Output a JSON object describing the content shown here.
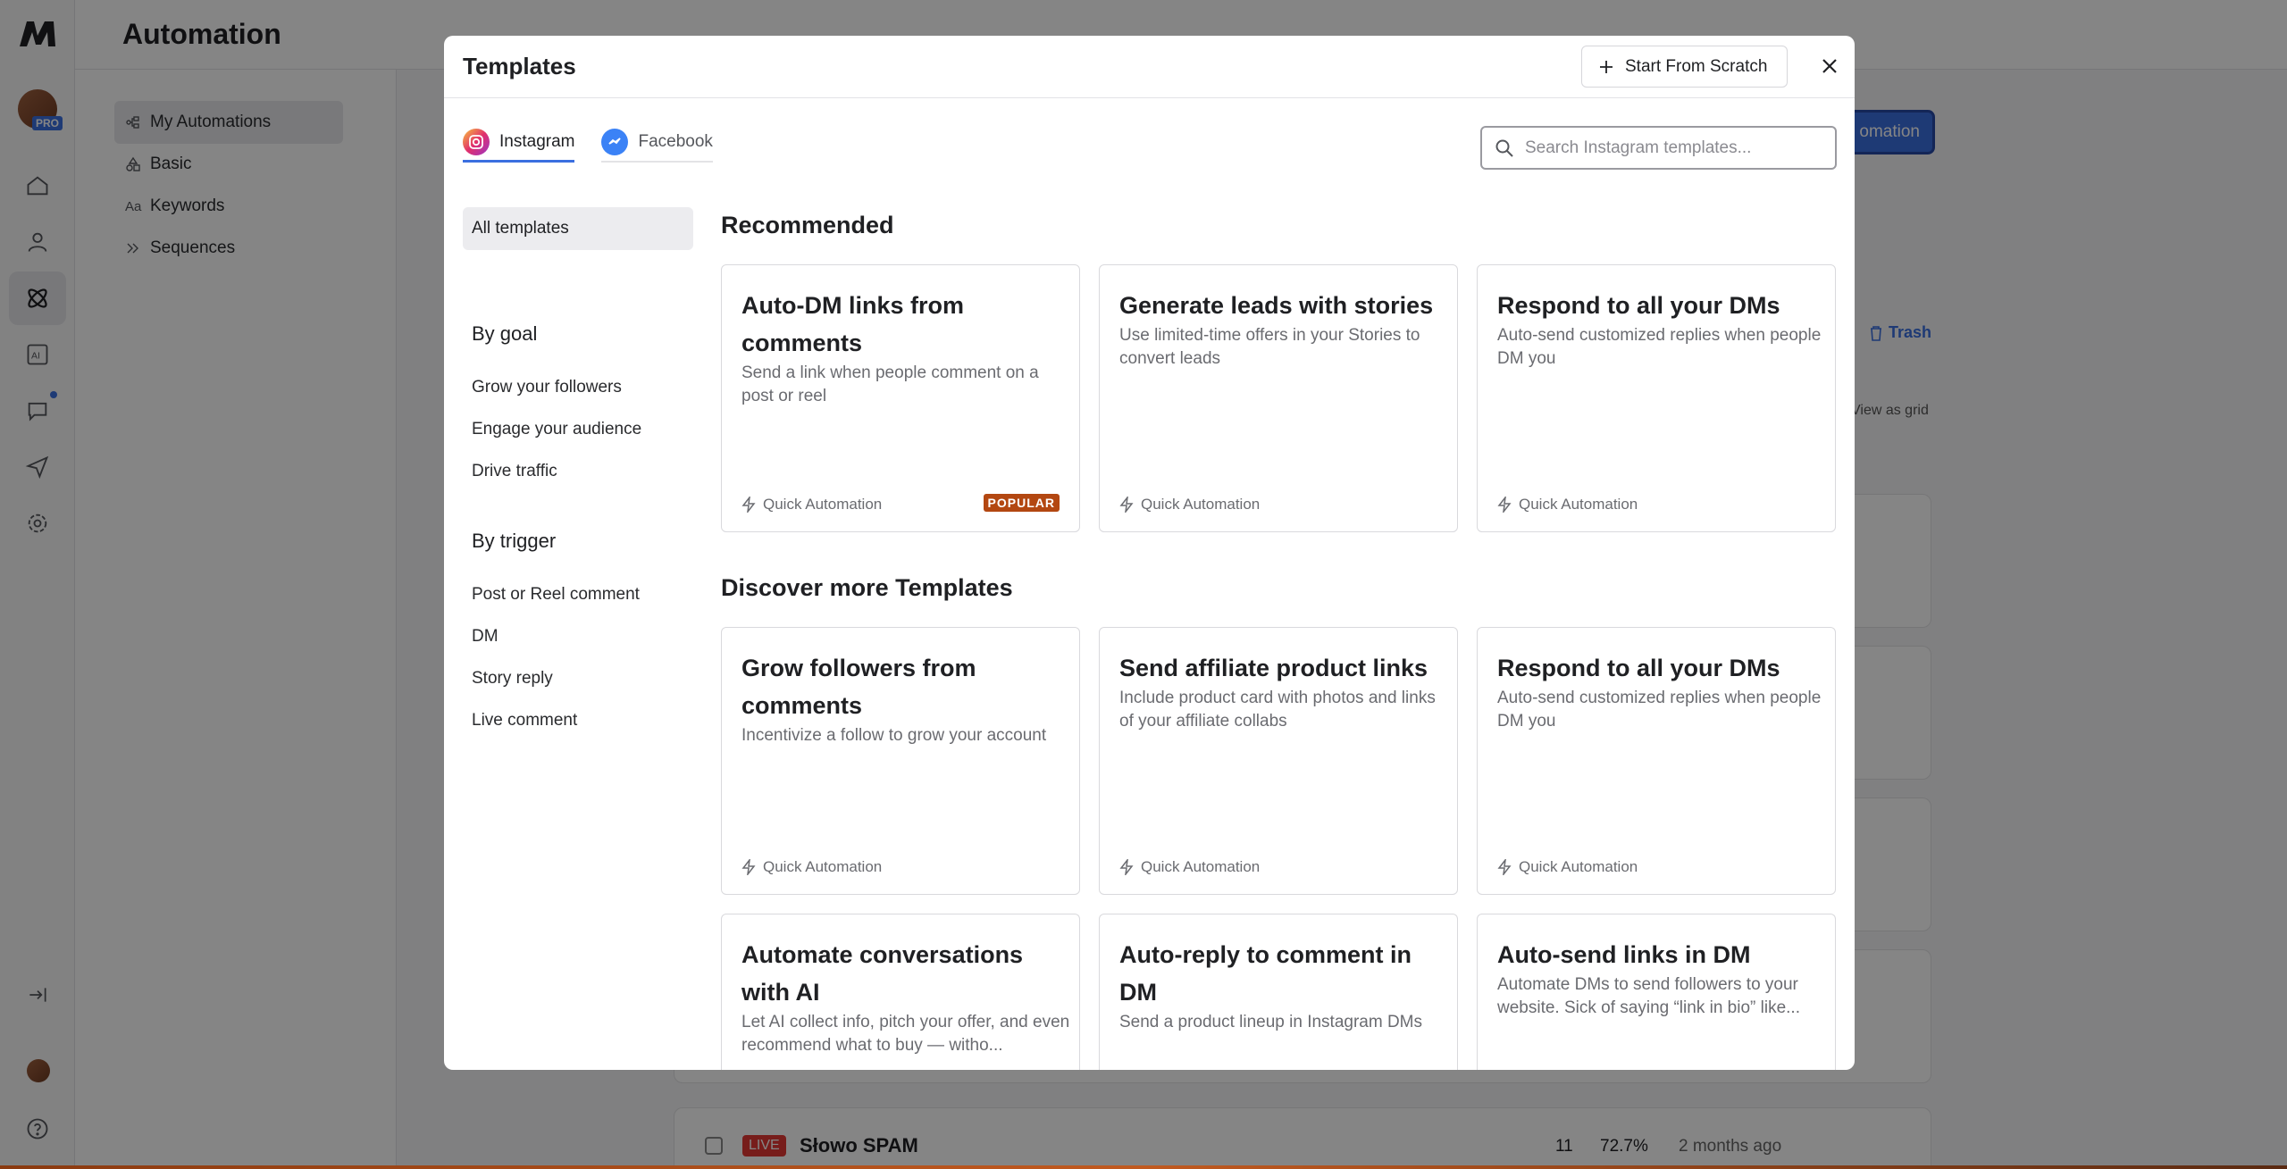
{
  "app": {
    "title": "Automation",
    "pro_badge": "PRO",
    "subnav": [
      "My Automations",
      "Basic",
      "Keywords",
      "Sequences"
    ],
    "new_automation_label": "omation",
    "trash_label": "Trash",
    "view_as_grid": "View as grid",
    "row": {
      "status": "LIVE",
      "name": "Słowo SPAM",
      "count": "11",
      "rate": "72.7%",
      "updated": "2 months ago"
    }
  },
  "modal": {
    "title": "Templates",
    "start_from_scratch": "Start From Scratch",
    "tabs": [
      {
        "label": "Instagram",
        "icon": "instagram-icon",
        "active": true
      },
      {
        "label": "Facebook",
        "icon": "messenger-icon",
        "active": false
      }
    ],
    "search": {
      "placeholder": "Search Instagram templates..."
    },
    "filters": {
      "all": "All templates",
      "by_goal_heading": "By goal",
      "by_goal": [
        "Grow your followers",
        "Engage your audience",
        "Drive traffic"
      ],
      "by_trigger_heading": "By trigger",
      "by_trigger": [
        "Post or Reel comment",
        "DM",
        "Story reply",
        "Live comment"
      ]
    },
    "recommended_heading": "Recommended",
    "discover_heading": "Discover more Templates",
    "recommended": [
      {
        "title": "Auto-DM links from comments",
        "desc": "Send a link when people comment on a post or reel",
        "foot": "Quick Automation",
        "badge": "POPULAR"
      },
      {
        "title": "Generate leads with stories",
        "desc": "Use limited-time offers in your Stories to convert leads",
        "foot": "Quick Automation"
      },
      {
        "title": "Respond to all your DMs",
        "desc": "Auto-send customized replies when people DM you",
        "foot": "Quick Automation"
      }
    ],
    "discover": [
      {
        "title": "Grow followers from comments",
        "desc": "Incentivize a follow to grow your account",
        "foot": "Quick Automation"
      },
      {
        "title": "Send affiliate product links",
        "desc": "Include product card with photos and links of your affiliate collabs",
        "foot": "Quick Automation"
      },
      {
        "title": "Respond to all your DMs",
        "desc": "Auto-send customized replies when people DM you",
        "foot": "Quick Automation"
      },
      {
        "title": "Automate conversations with AI",
        "desc": "Let AI collect info, pitch your offer, and even recommend what to buy — witho..."
      },
      {
        "title": "Auto-reply to comment in DM",
        "desc": "Send a product lineup in Instagram DMs"
      },
      {
        "title": "Auto-send links in DM",
        "desc": "Automate DMs to send followers to your website. Sick of saying “link in bio” like..."
      }
    ]
  }
}
